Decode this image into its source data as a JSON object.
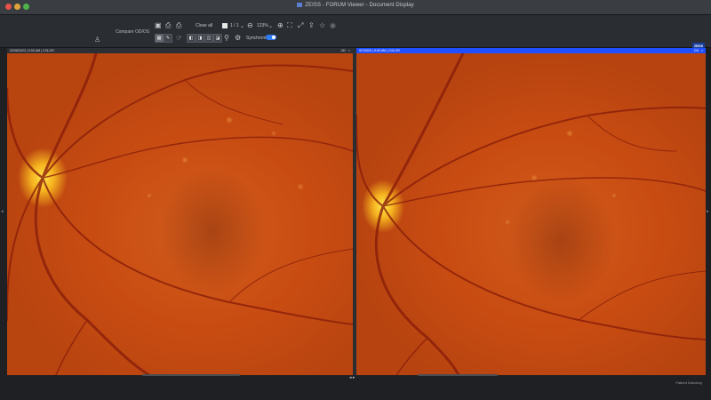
{
  "window": {
    "title": "ZEISS - FORUM Viewer - Document Display"
  },
  "toolbar": {
    "brand": "",
    "compare_label": "Compare OD/OS",
    "close_all": "Close all",
    "page_of": "1 / 1",
    "zoom": "123%",
    "sync_label": "Synchronize",
    "sync_on": true,
    "logo": "ZEISS",
    "icons": [
      "save-icon",
      "print-icon",
      "print-options-icon",
      "zoom-in-icon",
      "zoom-out-icon",
      "fit-icon",
      "fullscreen-icon",
      "export-icon",
      "star-icon",
      "eye-icon"
    ]
  },
  "panels": {
    "left": {
      "header": "02/08/2022 | 9:00 AM | COLOR",
      "eye": "OD",
      "close": "×"
    },
    "right": {
      "header": "9/7/2020 | 9:00 AM | COLOR",
      "eye": "OS",
      "close": "×"
    }
  },
  "status": {
    "bottom_right": "Patient Directory"
  },
  "colors": {
    "active_header": "#1f4fff",
    "toggle": "#2f7cf6",
    "fundus": "#c84c12"
  }
}
